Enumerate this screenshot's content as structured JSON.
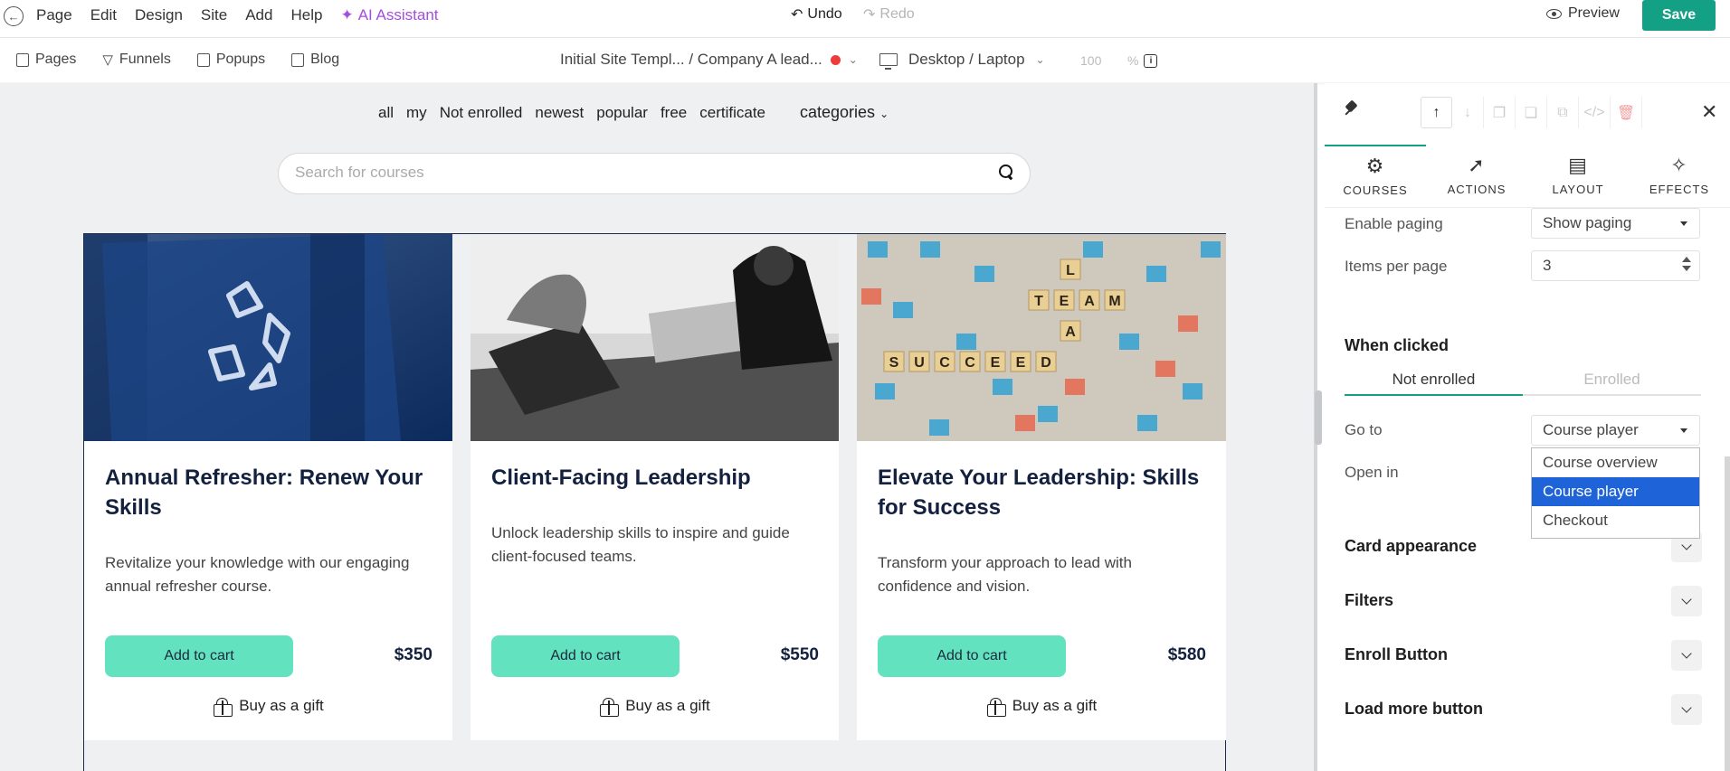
{
  "menubar": {
    "menus": [
      "Page",
      "Edit",
      "Design",
      "Site",
      "Add",
      "Help"
    ],
    "ai_assistant": "AI Assistant",
    "undo": "Undo",
    "redo": "Redo",
    "preview": "Preview",
    "save": "Save"
  },
  "toolbar": {
    "nav": [
      "Pages",
      "Funnels",
      "Popups",
      "Blog"
    ],
    "breadcrumb": "Initial Site Templ... / Company A lead...",
    "device": "Desktop / Laptop",
    "zoom": "100",
    "zoom_unit": "%"
  },
  "canvas": {
    "filters": [
      "all",
      "my",
      "Not enrolled",
      "newest",
      "popular",
      "free",
      "certificate"
    ],
    "categories": "categories",
    "search_placeholder": "Search for courses",
    "cards": [
      {
        "title": "Annual Refresher: Renew Your Skills",
        "desc": "Revitalize your knowledge with our engaging annual refresher course.",
        "cart": "Add to cart",
        "price": "$350",
        "gift": "Buy as a gift"
      },
      {
        "title": "Client-Facing Leadership",
        "desc": "Unlock leadership skills to inspire and guide client-focused teams.",
        "cart": "Add to cart",
        "price": "$550",
        "gift": "Buy as a gift"
      },
      {
        "title": "Elevate Your Leadership: Skills for Success",
        "desc": "Transform your approach to lead with confidence and vision.",
        "cart": "Add to cart",
        "price": "$580",
        "gift": "Buy as a gift"
      }
    ]
  },
  "panel": {
    "tabs": [
      "COURSES",
      "ACTIONS",
      "LAYOUT",
      "EFFECTS"
    ],
    "enable_paging_label": "Enable paging",
    "enable_paging_value": "Show paging",
    "items_per_page_label": "Items per page",
    "items_per_page_value": "3",
    "when_clicked": "When clicked",
    "subtabs": [
      "Not enrolled",
      "Enrolled"
    ],
    "go_to_label": "Go to",
    "go_to_value": "Course player",
    "open_in_label": "Open in",
    "dropdown_options": [
      "Course overview",
      "Course player",
      "Checkout"
    ],
    "sections": [
      "Card appearance",
      "Filters",
      "Enroll Button",
      "Load more button"
    ]
  },
  "colors": {
    "accent": "#14a085",
    "cart_button": "#63e2bf",
    "ai": "#a44de0",
    "selected_option": "#1f63d8"
  }
}
